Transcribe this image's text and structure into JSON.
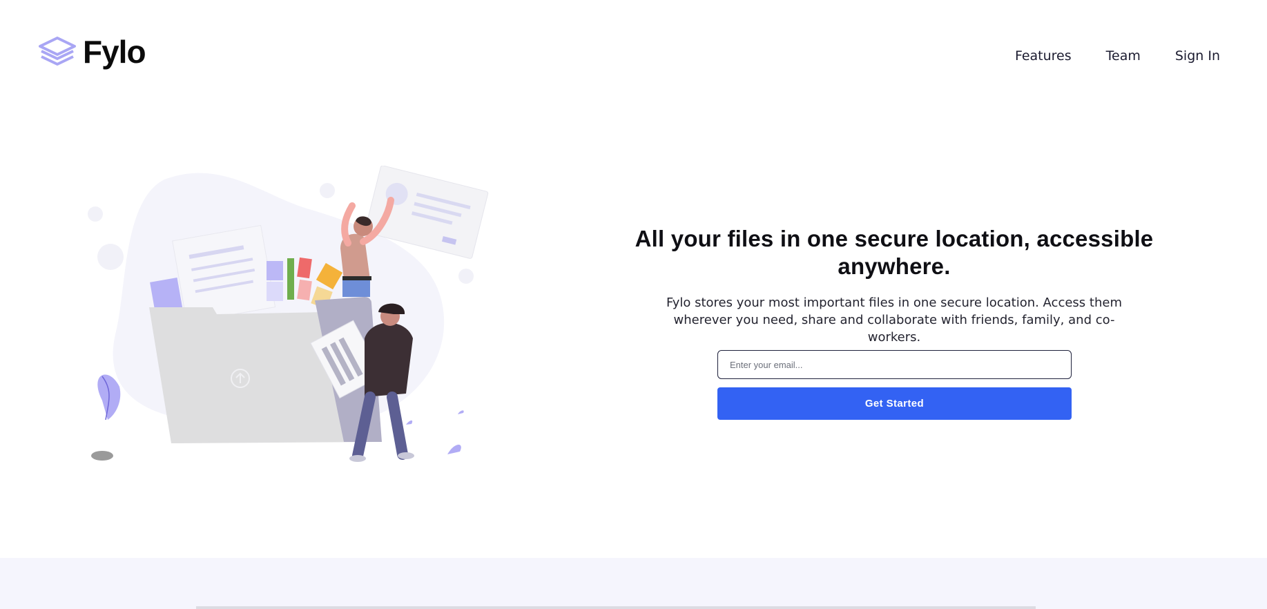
{
  "header": {
    "logo_text": "Fylo",
    "logo_icon": "layered-stack-icon",
    "nav": [
      {
        "label": "Features"
      },
      {
        "label": "Team"
      },
      {
        "label": "Sign In"
      }
    ]
  },
  "hero": {
    "title": "All your files in one secure location, accessible anywhere.",
    "description": "Fylo stores your most important files in one secure location. Access them wherever you need, share and collaborate with friends, family, and co-workers.",
    "email_placeholder": "Enter your email...",
    "cta_label": "Get Started",
    "illustration": "people-organizing-files-illustration"
  },
  "colors": {
    "accent": "#3362f3",
    "logo_purple": "#a7a4f3",
    "band": "#f5f5fd",
    "heading": "#0f0f14"
  }
}
